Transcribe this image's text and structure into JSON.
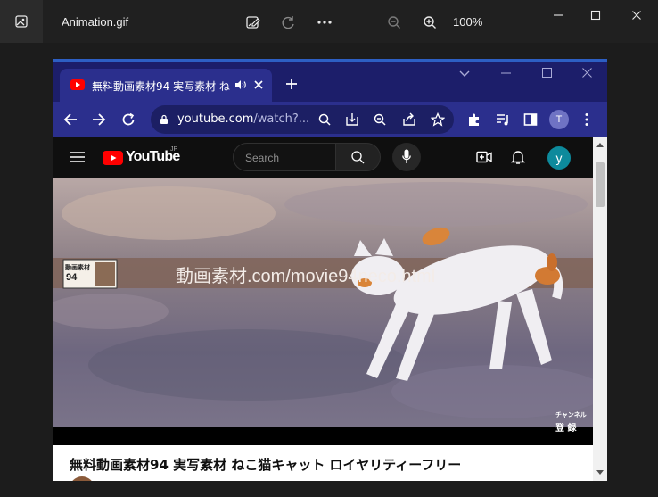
{
  "viewer": {
    "file_name": "Animation.gif",
    "zoom_level": "100%"
  },
  "browser": {
    "tab_title": "無料動画素材94 実写素材 ね",
    "url_host": "youtube.com",
    "url_path": "/watch?...",
    "profile_initial": "T"
  },
  "youtube": {
    "logo_text": "YouTube",
    "region": "JP",
    "search_placeholder": "Search",
    "avatar_initial": "y",
    "video_overlay_text": "動画素材.com/movie94neco.html",
    "badge_line1": "動画素材",
    "badge_line2": "94",
    "channel_mark_line1": "チャンネル",
    "channel_mark_line2": "登 録",
    "video_title": "無料動画素材94 実写素材 ねこ猫キャット ロイヤリティーフリー"
  }
}
